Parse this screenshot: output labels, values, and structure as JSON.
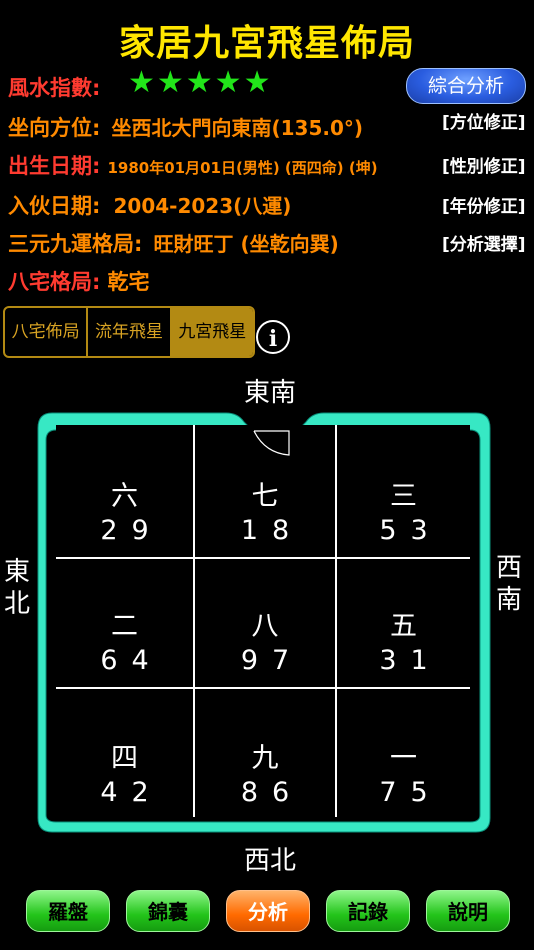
{
  "title": "家居九宮飛星佈局",
  "rating": {
    "label": "風水指數:",
    "stars": "★★★★★"
  },
  "analysis_button": "綜合分析",
  "rows": {
    "facing": {
      "label": "坐向方位:",
      "value": "坐西北大門向東南(135.0°)",
      "action": "[方位修正]"
    },
    "birth": {
      "label": "出生日期:",
      "value": "1980年01月01日(男性) (西四命) (坤)",
      "action": "[性別修正]"
    },
    "movein": {
      "label": "入伙日期:",
      "value": "2004-2023(八運)",
      "action": "[年份修正]"
    },
    "pattern": {
      "label": "三元九運格局:",
      "value": "旺財旺丁 (坐乾向巽)",
      "action": "[分析選擇]"
    },
    "house": {
      "label": "八宅格局:",
      "value": "乾宅"
    }
  },
  "tabs": [
    "八宅佈局",
    "流年飛星",
    "九宮飛星"
  ],
  "active_tab": 2,
  "info_icon": "i",
  "directions": {
    "top": "東南",
    "bottom": "西北",
    "left": "東\n北",
    "right": "西\n南"
  },
  "grid": [
    {
      "num": "六",
      "stars": "29"
    },
    {
      "num": "七",
      "stars": "18"
    },
    {
      "num": "三",
      "stars": "53"
    },
    {
      "num": "二",
      "stars": "64"
    },
    {
      "num": "八",
      "stars": "97"
    },
    {
      "num": "五",
      "stars": "31"
    },
    {
      "num": "四",
      "stars": "42"
    },
    {
      "num": "九",
      "stars": "86"
    },
    {
      "num": "一",
      "stars": "75"
    }
  ],
  "bottom_buttons": [
    "羅盤",
    "錦囊",
    "分析",
    "記錄",
    "說明"
  ],
  "colors": {
    "title": "#ffe600",
    "label": "#ff3b30",
    "value": "#ff8a00",
    "star": "#22e51a",
    "frame": "#37e8c4",
    "tab": "#b38a13"
  }
}
